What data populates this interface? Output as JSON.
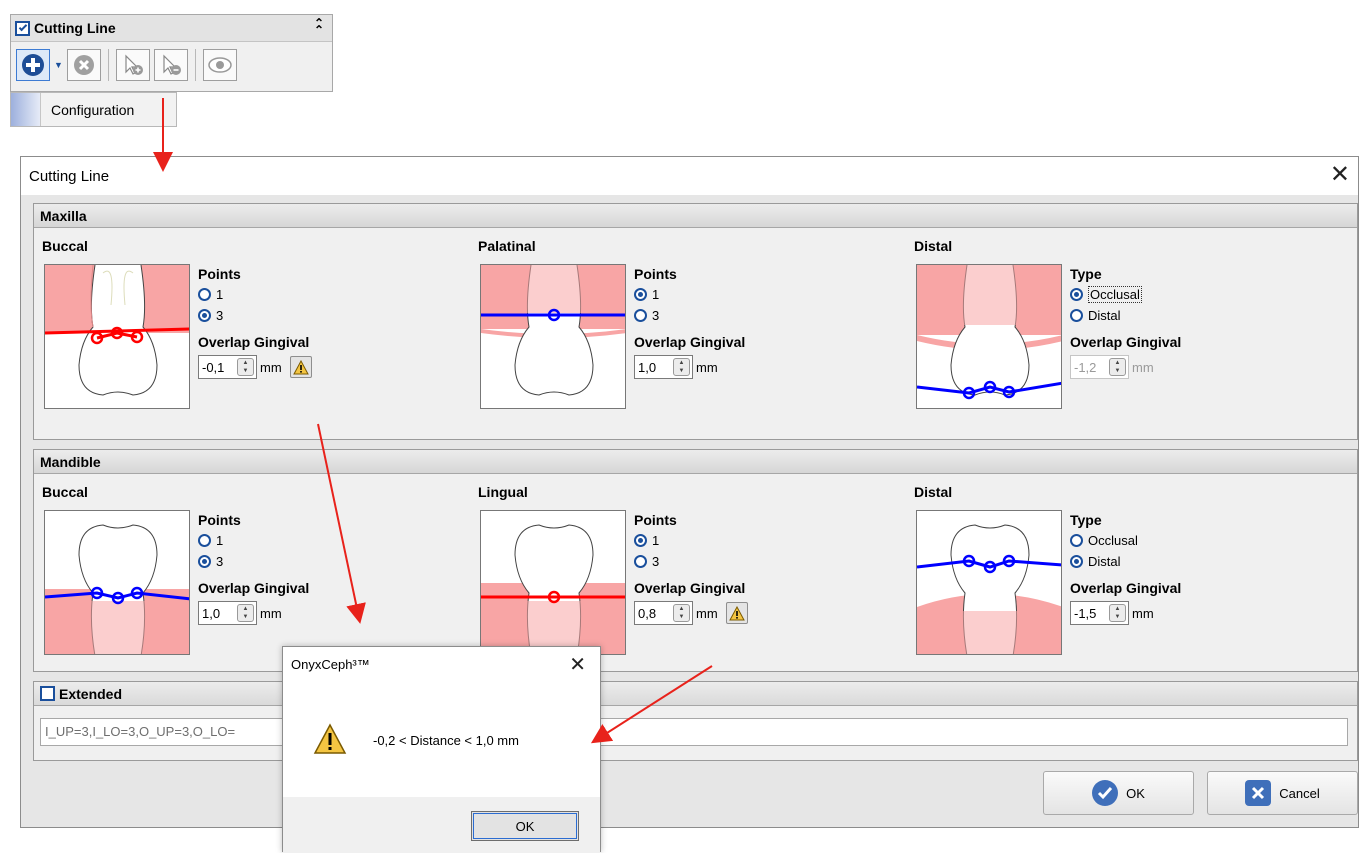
{
  "toolbar_panel": {
    "title": "Cutting Line",
    "menu_item": "Configuration"
  },
  "dialog": {
    "title": "Cutting Line",
    "maxilla": {
      "header": "Maxilla",
      "buccal": {
        "title": "Buccal",
        "options_title": "Points",
        "opt1": "1",
        "opt2": "3",
        "overlap_title": "Overlap Gingival",
        "value": "-0,1",
        "unit": "mm"
      },
      "palatinal": {
        "title": "Palatinal",
        "options_title": "Points",
        "opt1": "1",
        "opt2": "3",
        "overlap_title": "Overlap Gingival",
        "value": "1,0",
        "unit": "mm"
      },
      "distal": {
        "title": "Distal",
        "options_title": "Type",
        "opt1": "Occlusal",
        "opt2": "Distal",
        "overlap_title": "Overlap Gingival",
        "value": "-1,2",
        "unit": "mm"
      }
    },
    "mandible": {
      "header": "Mandible",
      "buccal": {
        "title": "Buccal",
        "options_title": "Points",
        "opt1": "1",
        "opt2": "3",
        "overlap_title": "Overlap Gingival",
        "value": "1,0",
        "unit": "mm"
      },
      "lingual": {
        "title": "Lingual",
        "options_title": "Points",
        "opt1": "1",
        "opt2": "3",
        "overlap_title": "Overlap Gingival",
        "value": "0,8",
        "unit": "mm"
      },
      "distal": {
        "title": "Distal",
        "options_title": "Type",
        "opt1": "Occlusal",
        "opt2": "Distal",
        "overlap_title": "Overlap Gingival",
        "value": "-1,5",
        "unit": "mm"
      }
    },
    "extended": {
      "header": "Extended",
      "value": "I_UP=3,I_LO=3,O_UP=3,O_LO="
    },
    "ok_label": "OK",
    "cancel_label": "Cancel"
  },
  "message_box": {
    "title": "OnyxCeph³™",
    "message": "-0,2 < Distance < 1,0 mm",
    "ok_label": "OK"
  },
  "colors": {
    "gingiva": "#f8a5a5",
    "line_red": "#ff0000",
    "line_blue": "#0000ff",
    "annotation_arrow": "#e8221b",
    "accent": "#1a4f9c"
  }
}
